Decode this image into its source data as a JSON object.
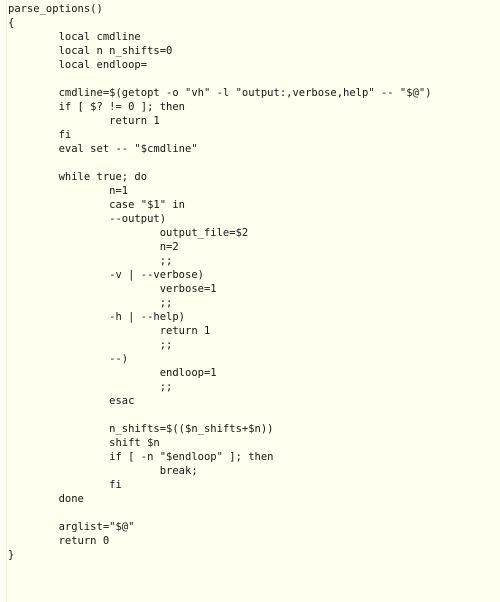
{
  "view": {
    "kind": "source-code-listing",
    "language": "bash",
    "function_name": "parse_options()",
    "background_color": "#fffff0",
    "text_color": "#151515",
    "gutter_color": "#fdfdf4",
    "gutter_rule_color": "#eeeedc",
    "font_size_px": 10.5,
    "line_height_px": 14,
    "tab_size": 8,
    "total_lines": 42
  },
  "code": {
    "lines": [
      "parse_options()",
      "{",
      "        local cmdline",
      "        local n n_shifts=0",
      "        local endloop=",
      "",
      "        cmdline=$(getopt -o \"vh\" -l \"output:,verbose,help\" -- \"$@\")",
      "        if [ $? != 0 ]; then",
      "                return 1",
      "        fi",
      "        eval set -- \"$cmdline\"",
      "",
      "        while true; do",
      "                n=1",
      "                case \"$1\" in",
      "                --output)",
      "                        output_file=$2",
      "                        n=2",
      "                        ;;",
      "                -v | --verbose)",
      "                        verbose=1",
      "                        ;;",
      "                -h | --help)",
      "                        return 1",
      "                        ;;",
      "                --)",
      "                        endloop=1",
      "                        ;;",
      "                esac",
      "",
      "                n_shifts=$(($n_shifts+$n))",
      "                shift $n",
      "                if [ -n \"$endloop\" ]; then",
      "                        break;",
      "                fi",
      "        done",
      "",
      "        arglist=\"$@\"",
      "        return 0",
      "}"
    ],
    "full_text": "parse_options()\n{\n        local cmdline\n        local n n_shifts=0\n        local endloop=\n\n        cmdline=$(getopt -o \"vh\" -l \"output:,verbose,help\" -- \"$@\")\n        if [ $? != 0 ]; then\n                return 1\n        fi\n        eval set -- \"$cmdline\"\n\n        while true; do\n                n=1\n                case \"$1\" in\n                --output)\n                        output_file=$2\n                        n=2\n                        ;;\n                -v | --verbose)\n                        verbose=1\n                        ;;\n                -h | --help)\n                        return 1\n                        ;;\n                --)\n                        endloop=1\n                        ;;\n                esac\n\n                n_shifts=$(($n_shifts+$n))\n                shift $n\n                if [ -n \"$endloop\" ]; then\n                        break;\n                fi\n        done\n\n        arglist=\"$@\"\n        return 0\n}"
  }
}
